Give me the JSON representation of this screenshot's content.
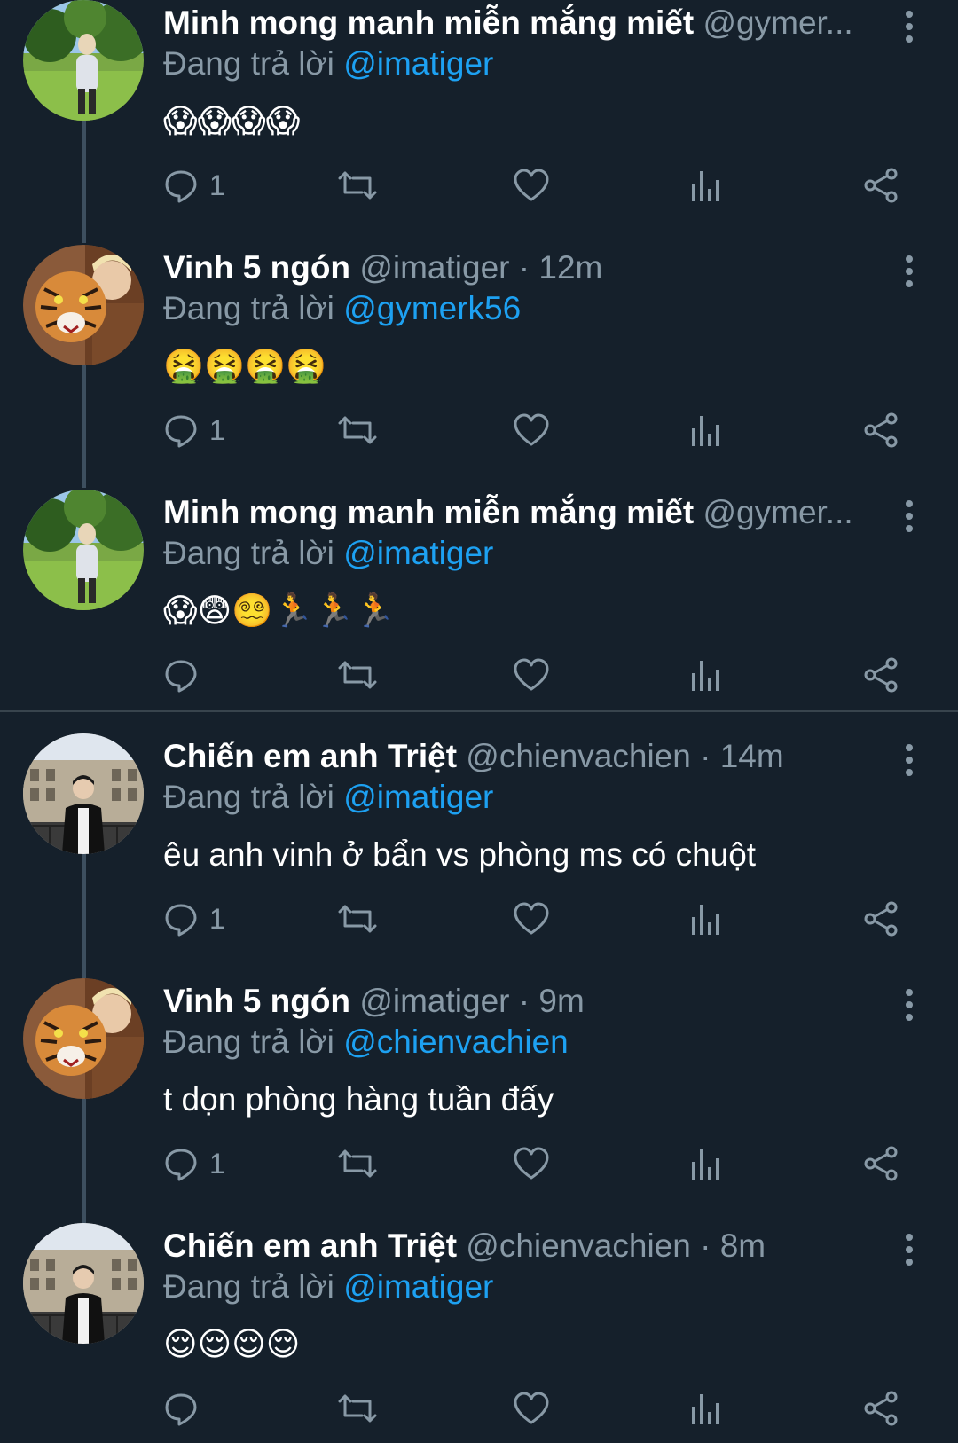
{
  "tweets": [
    {
      "display_name": "Minh mong manh miễn mắng miết",
      "handle": "@gymer...",
      "dot": "",
      "time": "",
      "reply_prefix": "Đang trả lời",
      "reply_to": "@imatiger",
      "body": "😱😱😱😱",
      "reply_count": "1",
      "avatar": "park-avatar"
    },
    {
      "display_name": "Vinh 5 ngón",
      "handle": "@imatiger",
      "dot": "·",
      "time": "12m",
      "reply_prefix": "Đang trả lời",
      "reply_to": "@gymerk56",
      "body": "🤮🤮🤮🤮",
      "reply_count": "1",
      "avatar": "tiger-avatar"
    },
    {
      "display_name": "Minh mong manh miễn mắng miết",
      "handle": "@gymer...",
      "dot": "",
      "time": "",
      "reply_prefix": "Đang trả lời",
      "reply_to": "@imatiger",
      "body": "😱😨😵‍💫🏃🏃🏃",
      "reply_count": "",
      "avatar": "park-avatar"
    },
    {
      "display_name": "Chiến em anh Triệt",
      "handle": "@chienvachien",
      "dot": "·",
      "time": "14m",
      "reply_prefix": "Đang trả lời",
      "reply_to": "@imatiger",
      "body": "êu anh vinh ở bẩn vs phòng ms có chuột",
      "reply_count": "1",
      "avatar": "city-avatar"
    },
    {
      "display_name": "Vinh 5 ngón",
      "handle": "@imatiger",
      "dot": "·",
      "time": "9m",
      "reply_prefix": "Đang trả lời",
      "reply_to": "@chienvachien",
      "body": "t dọn phòng hàng tuần đấy",
      "reply_count": "1",
      "avatar": "tiger-avatar"
    },
    {
      "display_name": "Chiến em anh Triệt",
      "handle": "@chienvachien",
      "dot": "·",
      "time": "8m",
      "reply_prefix": "Đang trả lời",
      "reply_to": "@imatiger",
      "body": "😌😌😌😌",
      "reply_count": "",
      "avatar": "city-avatar"
    }
  ],
  "icons": {
    "more": "more-vertical-icon",
    "reply": "reply-icon",
    "retweet": "retweet-icon",
    "like": "like-icon",
    "analytics": "analytics-icon",
    "share": "share-icon"
  },
  "colors": {
    "background": "#15202b",
    "muted_text": "#8899a6",
    "mention": "#1da1f2",
    "thread_line": "#3d4f5f",
    "divider": "#38444d"
  }
}
